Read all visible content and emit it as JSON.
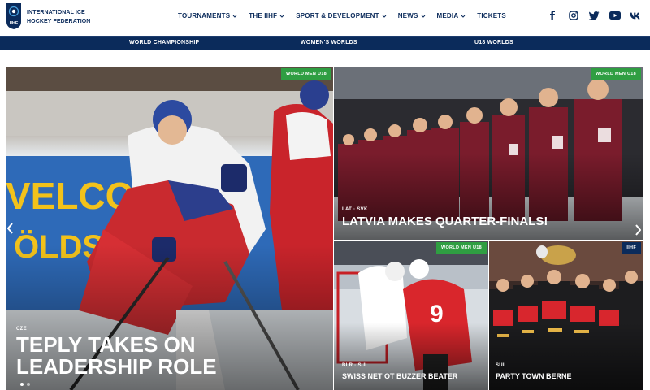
{
  "brand": {
    "logo_text": "IIHF",
    "name_line1": "INTERNATIONAL ICE",
    "name_line2": "HOCKEY FEDERATION"
  },
  "nav": [
    {
      "label": "TOURNAMENTS",
      "has_dropdown": true
    },
    {
      "label": "THE IIHF",
      "has_dropdown": true
    },
    {
      "label": "SPORT & DEVELOPMENT",
      "has_dropdown": true
    },
    {
      "label": "NEWS",
      "has_dropdown": true
    },
    {
      "label": "MEDIA",
      "has_dropdown": true
    },
    {
      "label": "TICKETS",
      "has_dropdown": false
    }
  ],
  "social": [
    "facebook-icon",
    "instagram-icon",
    "twitter-icon",
    "youtube-icon",
    "vk-icon"
  ],
  "subnav": [
    "WORLD CHAMPIONSHIP",
    "WOMEN'S WORLDS",
    "U18 WORLDS"
  ],
  "tiles": [
    {
      "badge": "WORLD MEN U18",
      "tag": "CZE",
      "headline_line1": "TEPLY TAKES ON",
      "headline_line2": "LEADERSHIP ROLE"
    },
    {
      "badge": "WORLD MEN U18",
      "tag": "LAT · SVK",
      "headline_line1": "LATVIA MAKES QUARTER-FINALS!"
    },
    {
      "badge": "WORLD MEN U18",
      "tag": "BLR · SUI",
      "headline_line1": "SWISS NET OT BUZZER BEATER"
    },
    {
      "badge": "IIHF",
      "tag": "SUI",
      "headline_line1": "PARTY TOWN BERNE"
    }
  ],
  "colors": {
    "navy": "#0b2b5b",
    "badge_green": "#2f9e42",
    "white": "#ffffff"
  },
  "slider": {
    "slide_count": 2,
    "active_index": 0
  }
}
